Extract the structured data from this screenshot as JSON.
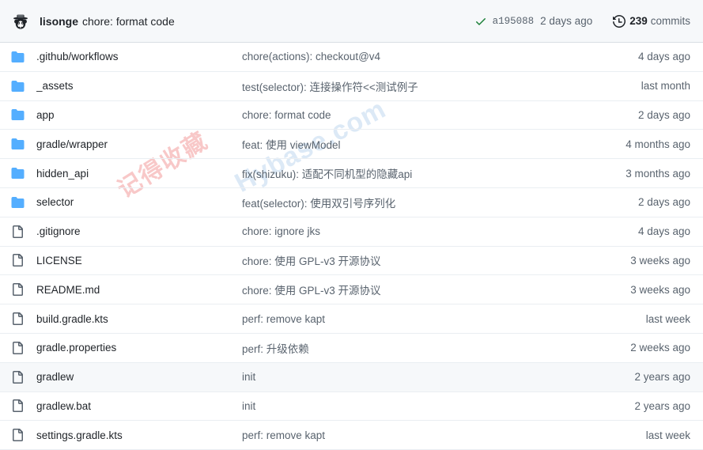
{
  "header": {
    "avatar_name": "user-avatar",
    "author": "lisonge",
    "message": "chore: format code",
    "status_icon": "check-icon",
    "commit_sha": "a195088",
    "commit_date": "2 days ago",
    "history_icon": "history-icon",
    "commit_count": "239",
    "commits_label": "commits",
    "accent_green": "#1a7f37",
    "background": "#f6f8fa"
  },
  "watermark": {
    "red_text": "记得收藏",
    "blue_text": "Hybase.com"
  },
  "colors": {
    "folder_blue": "#54aeff",
    "file_gray": "#59636e",
    "row_border": "#eaeef2",
    "row_highlight": "#f6f8fa"
  },
  "files": [
    {
      "type": "folder",
      "icon": "folder-icon",
      "name": ".github/workflows",
      "message": "chore(actions): checkout@v4",
      "age": "4 days ago",
      "highlight": false
    },
    {
      "type": "folder",
      "icon": "folder-icon",
      "name": "_assets",
      "message": "test(selector): 连接操作符<<测试例子",
      "age": "last month",
      "highlight": false
    },
    {
      "type": "folder",
      "icon": "folder-icon",
      "name": "app",
      "message": "chore: format code",
      "age": "2 days ago",
      "highlight": false
    },
    {
      "type": "folder",
      "icon": "folder-icon",
      "name": "gradle/wrapper",
      "message": "feat: 使用 viewModel",
      "age": "4 months ago",
      "highlight": false
    },
    {
      "type": "folder",
      "icon": "folder-icon",
      "name": "hidden_api",
      "message": "fix(shizuku): 适配不同机型的隐藏api",
      "age": "3 months ago",
      "highlight": false
    },
    {
      "type": "folder",
      "icon": "folder-icon",
      "name": "selector",
      "message": "feat(selector): 使用双引号序列化",
      "age": "2 days ago",
      "highlight": false
    },
    {
      "type": "file",
      "icon": "file-icon",
      "name": ".gitignore",
      "message": "chore: ignore jks",
      "age": "4 days ago",
      "highlight": false
    },
    {
      "type": "file",
      "icon": "file-icon",
      "name": "LICENSE",
      "message": "chore: 使用 GPL-v3 开源协议",
      "age": "3 weeks ago",
      "highlight": false
    },
    {
      "type": "file",
      "icon": "file-icon",
      "name": "README.md",
      "message": "chore: 使用 GPL-v3 开源协议",
      "age": "3 weeks ago",
      "highlight": false
    },
    {
      "type": "file",
      "icon": "file-icon",
      "name": "build.gradle.kts",
      "message": "perf: remove kapt",
      "age": "last week",
      "highlight": false
    },
    {
      "type": "file",
      "icon": "file-icon",
      "name": "gradle.properties",
      "message": "perf: 升级依赖",
      "age": "2 weeks ago",
      "highlight": false
    },
    {
      "type": "file",
      "icon": "file-icon",
      "name": "gradlew",
      "message": "init",
      "age": "2 years ago",
      "highlight": true
    },
    {
      "type": "file",
      "icon": "file-icon",
      "name": "gradlew.bat",
      "message": "init",
      "age": "2 years ago",
      "highlight": false
    },
    {
      "type": "file",
      "icon": "file-icon",
      "name": "settings.gradle.kts",
      "message": "perf: remove kapt",
      "age": "last week",
      "highlight": false
    }
  ]
}
